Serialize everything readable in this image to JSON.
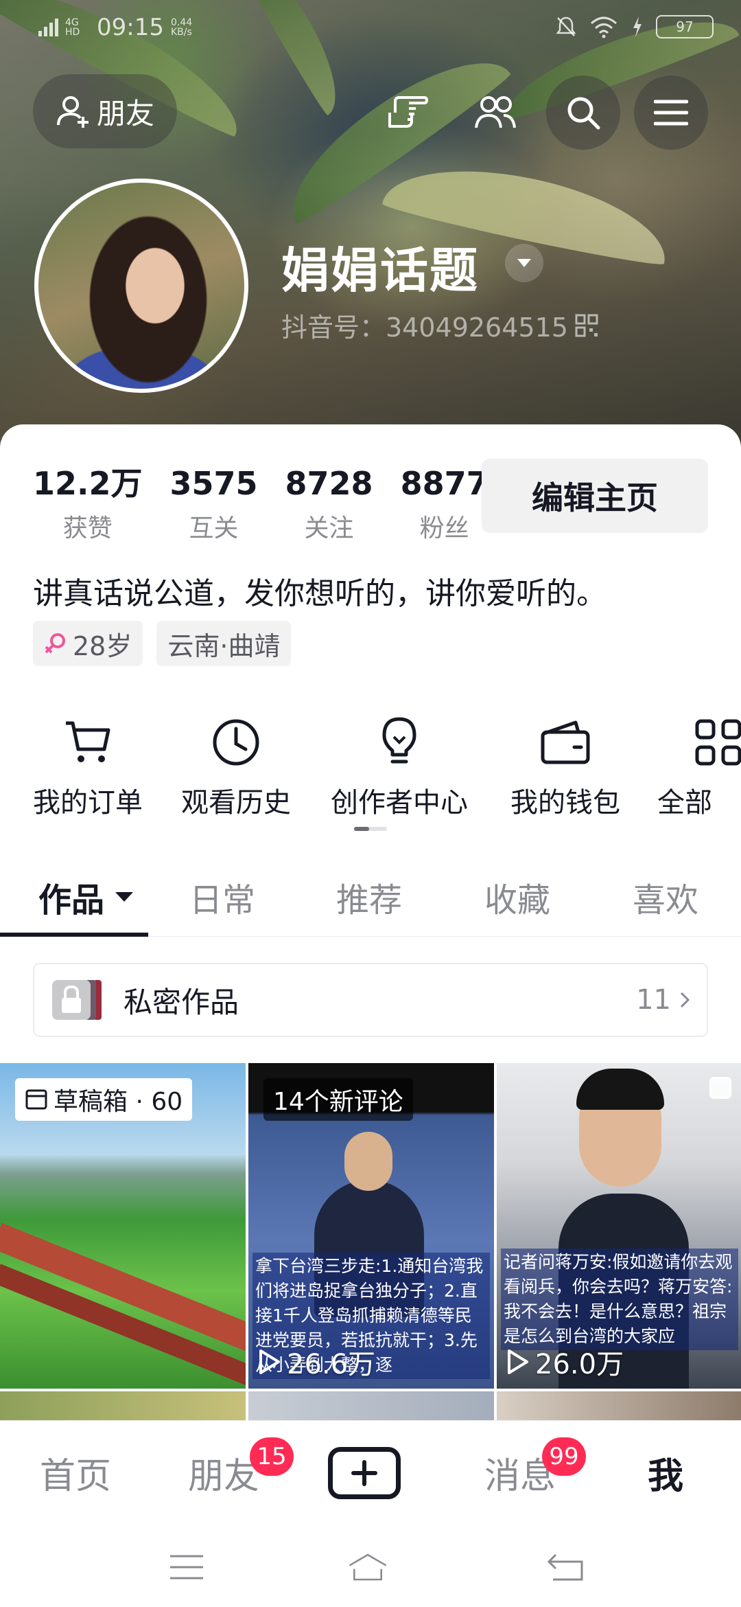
{
  "status_bar": {
    "network": "4G HD",
    "time": "09:15",
    "speed": "0.44 KB/s",
    "battery": "97"
  },
  "header": {
    "friend_button_label": "朋友",
    "display_name": "娟娟话题",
    "douyin_id": "抖音号：34049264515"
  },
  "stats": [
    {
      "value": "12.2万",
      "label": "获赞"
    },
    {
      "value": "3575",
      "label": "互关"
    },
    {
      "value": "8728",
      "label": "关注"
    },
    {
      "value": "8877",
      "label": "粉丝"
    }
  ],
  "edit_profile_label": "编辑主页",
  "bio": "讲真话说公道，发你想听的，讲你爱听的。",
  "tags": [
    {
      "text": "28岁",
      "icon": "female-icon"
    },
    {
      "text": "云南·曲靖"
    }
  ],
  "quick_actions": [
    {
      "label": "我的订单",
      "icon": "cart-icon"
    },
    {
      "label": "观看历史",
      "icon": "clock-icon"
    },
    {
      "label": "创作者中心",
      "icon": "lightbulb-icon"
    },
    {
      "label": "我的钱包",
      "icon": "wallet-icon"
    },
    {
      "label": "全部",
      "icon": "grid-icon"
    }
  ],
  "tabs": [
    {
      "label": "作品",
      "active": true
    },
    {
      "label": "日常"
    },
    {
      "label": "推荐"
    },
    {
      "label": "收藏"
    },
    {
      "label": "喜欢"
    }
  ],
  "private_works": {
    "label": "私密作品",
    "count": "11"
  },
  "videos": [
    {
      "badge": "草稿箱 · 60"
    },
    {
      "badge": "14个新评论",
      "caption": "拿下台湾三步走:1.通知台湾我们将进岛捉拿台独分子；2.直接1千人登岛抓捕赖清德等民进党要员，若抵抗就干；3.先从小弄到大整，逐",
      "plays": "26.6万"
    },
    {
      "caption": "记者问蒋万安:假如邀请你去观看阅兵，你会去吗？蒋万安答:我不会去！是什么意思？祖宗是怎么到台湾的大家应",
      "plays": "26.0万"
    }
  ],
  "bottom_nav": [
    {
      "label": "首页"
    },
    {
      "label": "朋友",
      "badge": "15"
    },
    {
      "label": "发布",
      "icon": "plus-icon"
    },
    {
      "label": "消息",
      "badge": "99"
    },
    {
      "label": "我",
      "active": true
    }
  ],
  "colors": {
    "accent": "#fe2c55",
    "text": "#161823",
    "muted": "#8a8b91"
  }
}
